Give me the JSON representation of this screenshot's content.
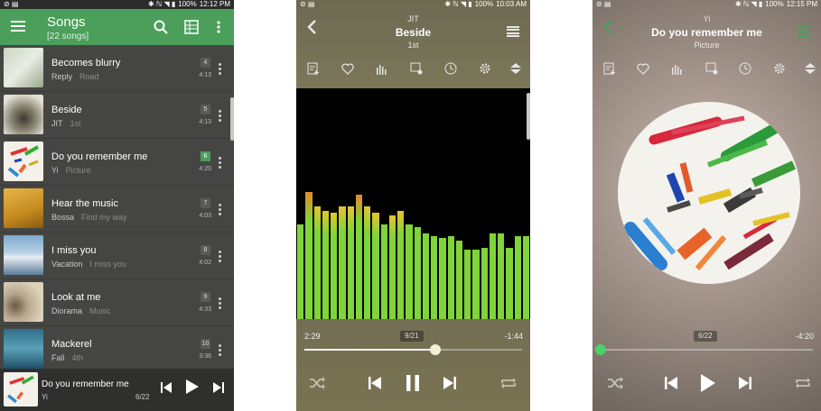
{
  "colors": {
    "accent": "#4b9f5a",
    "viz_green": "#7fd43a",
    "viz_orange": "#e48a2a",
    "viz_yellow": "#e6c52e"
  },
  "statusbar": [
    {
      "left_icons": "⊘ ▤",
      "right_icons": "✱ ℕ ◥ ▮",
      "battery": "100%",
      "time": "12:12 PM"
    },
    {
      "left_icons": "⊘ ▤",
      "right_icons": "✱ ℕ ◥ ▮",
      "battery": "100%",
      "time": "10:03 AM"
    },
    {
      "left_icons": "⊘ ▤",
      "right_icons": "✱ ℕ ◥ ▮",
      "battery": "100%",
      "time": "12:15 PM"
    }
  ],
  "library": {
    "title": "Songs",
    "subtitle": "[22 songs]",
    "icons": {
      "menu": "menu-icon",
      "search": "search-icon",
      "view": "grid-view-icon",
      "more": "more-vert-icon"
    },
    "songs": [
      {
        "title": "Becomes blurry",
        "artist": "Reply",
        "album": "Road",
        "track": "4",
        "duration": "4:13",
        "active": false
      },
      {
        "title": "Beside",
        "artist": "JIT",
        "album": "1st",
        "track": "5",
        "duration": "4:13",
        "active": false
      },
      {
        "title": "Do you remember me",
        "artist": "Yi",
        "album": "Picture",
        "track": "6",
        "duration": "4:20",
        "active": true
      },
      {
        "title": "Hear the music",
        "artist": "Bossa",
        "album": "Find my way",
        "track": "7",
        "duration": "4:03",
        "active": false
      },
      {
        "title": "I miss you",
        "artist": "Vacation",
        "album": "I miss you",
        "track": "8",
        "duration": "4:02",
        "active": false
      },
      {
        "title": "Look at me",
        "artist": "Diorama",
        "album": "Music",
        "track": "9",
        "duration": "4:33",
        "active": false
      },
      {
        "title": "Mackerel",
        "artist": "Fall",
        "album": "4th",
        "track": "10",
        "duration": "3:36",
        "active": false
      }
    ],
    "mini_player": {
      "title": "Do you remember me",
      "artist": "Yi",
      "position": "6/22"
    }
  },
  "player_visualizer": {
    "artist": "JIT",
    "title": "Beside",
    "album": "1st",
    "elapsed": "2:29",
    "remaining": "-1:44",
    "position": "9/21",
    "progress": 0.6,
    "levels": [
      0.41,
      0.55,
      0.49,
      0.47,
      0.46,
      0.49,
      0.49,
      0.54,
      0.49,
      0.46,
      0.41,
      0.45,
      0.47,
      0.41,
      0.4,
      0.37,
      0.36,
      0.35,
      0.36,
      0.34,
      0.3,
      0.3,
      0.31,
      0.37,
      0.37,
      0.31,
      0.36,
      0.36
    ]
  },
  "player_artwork": {
    "artist": "Yi",
    "title": "Do you remember me",
    "album": "Picture",
    "elapsed": "",
    "remaining": "-4:20",
    "position": "6/22",
    "progress": 0.0
  }
}
